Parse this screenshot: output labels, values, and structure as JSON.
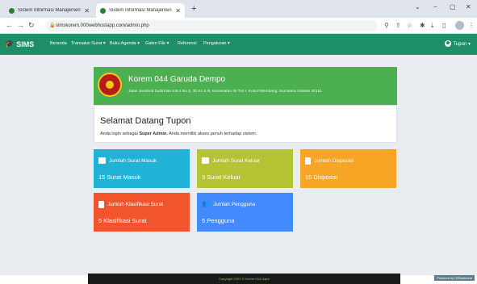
{
  "browser": {
    "tabs": [
      {
        "title": "Sistem Informasi Manajemen Su",
        "active": false
      },
      {
        "title": "Sistem Informasi Manajemen Su",
        "active": true
      }
    ],
    "new_tab_symbol": "+",
    "window_controls": [
      "⌄",
      "−",
      "▢",
      "✕"
    ],
    "url": "simskorem.000webhostapp.com/admin.php"
  },
  "navbar": {
    "brand": "SIMS",
    "menu": [
      "Beranda",
      "Transaksi Surat ▾",
      "Buku Agenda ▾",
      "Galeri File ▾",
      "Referensi",
      "Pengaturan ▾"
    ],
    "user": "Tupon ▾",
    "color": "#1e8e68"
  },
  "header": {
    "title": "Korem 044 Garuda Dempo",
    "address": "Jalan Jenderal Sudirman KM 4 No 5, 30 Kc 9 Ilr, Kecamatan Ilir Tim I, Kota Palembang, Sumatera Selatan 30151",
    "color": "#4caf50"
  },
  "welcome": {
    "title": "Selamat Datang Tupon",
    "sub_prefix": "Anda login sebagai ",
    "sub_role": "Super Admin.",
    "sub_suffix": " Anda memiliki akses penuh terhadap sistem."
  },
  "cards": [
    {
      "label": "Jumlah Surat Masuk",
      "value": "15 Surat Masuk",
      "icon": "mail-icon",
      "color": "#21b3d6"
    },
    {
      "label": "Jumlah Surat Keluar",
      "value": "3 Surat Keluar",
      "icon": "outbox-icon",
      "color": "#b5c334"
    },
    {
      "label": "Jumlah Disposisi",
      "value": "15 Disposisi",
      "icon": "document-icon",
      "color": "#f7a524"
    },
    {
      "label": "Jumlah Klasifikasi Surat",
      "value": "5 Klasifikasi Surat",
      "icon": "book-icon",
      "color": "#f2552c"
    },
    {
      "label": "Jumlah Pengguna",
      "value": "5 Pengguna",
      "icon": "users-icon",
      "color": "#448aff"
    }
  ],
  "footer": {
    "text": "Copyright 2021 © Korem 044 Gapo"
  },
  "promo": "Powered by 000webhost"
}
